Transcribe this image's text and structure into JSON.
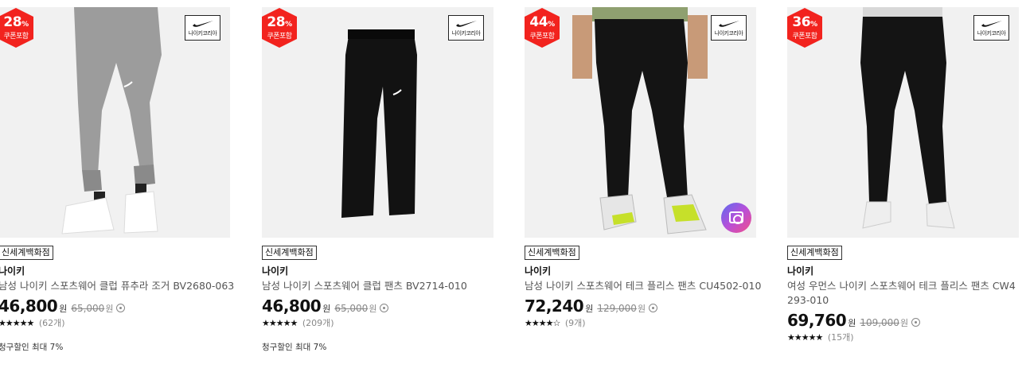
{
  "products": [
    {
      "discount_pct": "28",
      "discount_unit": "%",
      "coupon_label": "쿠폰포함",
      "logo_text": "나이키코리아",
      "store_tag": "신세계백화점",
      "brand": "나이키",
      "title": "남성 나이키 스포츠웨어 클럽 퓨추라 조거 BV2680-063",
      "price": "46,800",
      "price_unit": "원",
      "original_price": "65,000",
      "original_unit": "원",
      "stars": "★★★★★",
      "review_count": "(62개)",
      "card_discount": "청구할인 최대 7%",
      "product_color": "#9a9a9a"
    },
    {
      "discount_pct": "28",
      "discount_unit": "%",
      "coupon_label": "쿠폰포함",
      "logo_text": "나이키코리아",
      "store_tag": "신세계백화점",
      "brand": "나이키",
      "title": "남성 나이키 스포츠웨어 클럽 팬츠 BV2714-010",
      "price": "46,800",
      "price_unit": "원",
      "original_price": "65,000",
      "original_unit": "원",
      "stars": "★★★★★",
      "review_count": "(209개)",
      "card_discount": "청구할인 최대 7%",
      "product_color": "#141414"
    },
    {
      "discount_pct": "44",
      "discount_unit": "%",
      "coupon_label": "쿠폰포함",
      "logo_text": "나이키코리아",
      "store_tag": "신세계백화점",
      "brand": "나이키",
      "title": "남성 나이키 스포츠웨어 테크 플리스 팬츠 CU4502-010",
      "price": "72,240",
      "price_unit": "원",
      "original_price": "129,000",
      "original_unit": "원",
      "stars": "★★★★☆",
      "review_count": "(9개)",
      "card_discount": "",
      "product_color": "#141414"
    },
    {
      "discount_pct": "36",
      "discount_unit": "%",
      "coupon_label": "쿠폰포함",
      "logo_text": "나이키코리아",
      "store_tag": "신세계백화점",
      "brand": "나이키",
      "title": "여성 우먼스 나이키 스포츠웨어 테크 플리스 팬츠 CW4293-010",
      "price": "69,760",
      "price_unit": "원",
      "original_price": "109,000",
      "original_unit": "원",
      "stars": "★★★★★",
      "review_count": "(15개)",
      "card_discount": "",
      "product_color": "#141414"
    }
  ],
  "colors": {
    "badge": "#f2231e",
    "background_thumb": "#f2f2f2"
  }
}
